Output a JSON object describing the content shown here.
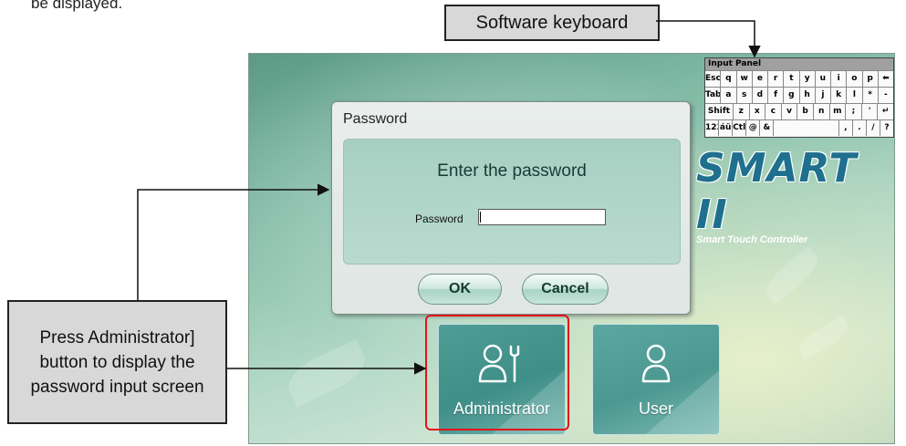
{
  "top_note": "be displayed.",
  "callouts": {
    "keyboard": "Software keyboard",
    "admin": "Press Administrator] button to display the password input screen"
  },
  "keyboard": {
    "title": "Input Panel",
    "rows": [
      [
        "Esc",
        "q",
        "w",
        "e",
        "r",
        "t",
        "y",
        "u",
        "i",
        "o",
        "p",
        "⬅"
      ],
      [
        "Tab",
        "a",
        "s",
        "d",
        "f",
        "g",
        "h",
        "j",
        "k",
        "l",
        "*",
        "-"
      ],
      [
        "Shift",
        "z",
        "x",
        "c",
        "v",
        "b",
        "n",
        "m",
        ";",
        "'",
        "↵"
      ],
      [
        "123",
        "áü",
        "Ctl",
        "@",
        "&",
        "",
        ",",
        ".",
        "/",
        "?"
      ]
    ]
  },
  "logo": {
    "text": "SMART II",
    "subtitle": "Smart Touch Controller"
  },
  "dialog": {
    "title": "Password",
    "heading": "Enter the password",
    "field_label": "Password",
    "field_value": "",
    "ok_label": "OK",
    "cancel_label": "Cancel"
  },
  "tiles": {
    "admin_label": "Administrator",
    "user_label": "User",
    "admin_icon": "admin-wrench-icon",
    "user_icon": "user-icon"
  },
  "colors": {
    "highlight": "#e2141a",
    "logo": "#1f6f8e",
    "tile": "#4a9893"
  }
}
